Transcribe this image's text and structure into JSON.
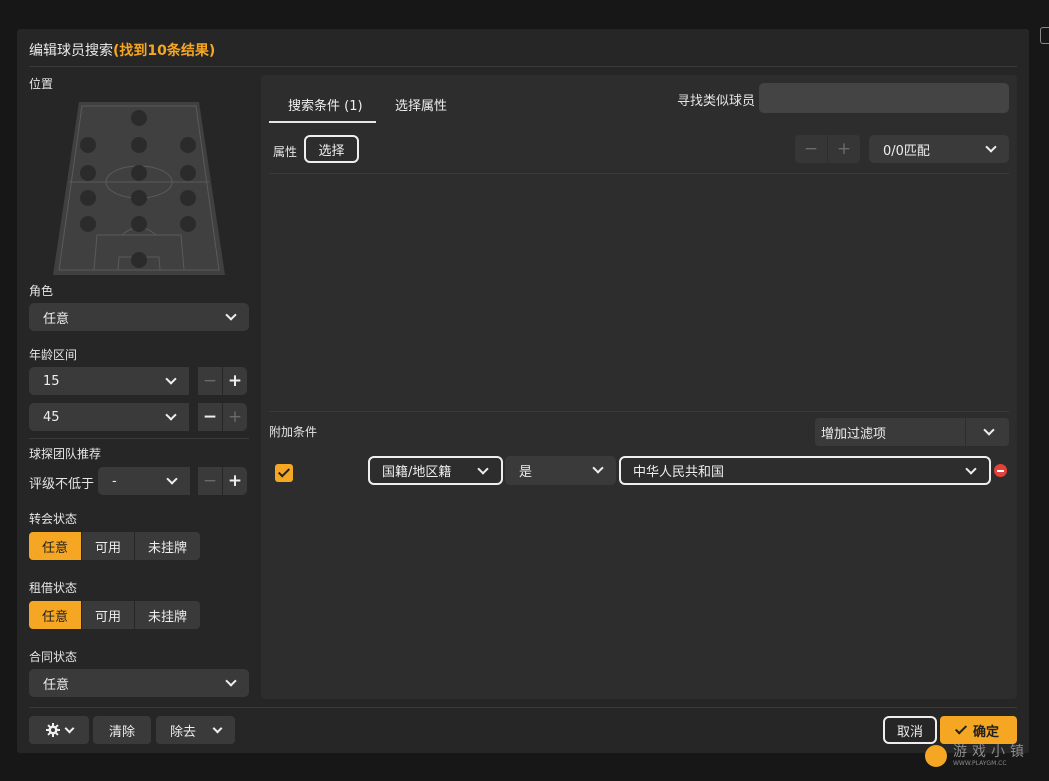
{
  "dialog": {
    "title_prefix": "编辑球员搜索",
    "title_count": "(找到10条结果)"
  },
  "left": {
    "position_label": "位置",
    "role_label": "角色",
    "role_value": "任意",
    "age_label": "年龄区间",
    "age_min": "15",
    "age_max": "45",
    "scout_label": "球探团队推荐",
    "rating_label": "评级不低于",
    "rating_value": "-",
    "transfer_label": "转会状态",
    "transfer_options": [
      "任意",
      "可用",
      "未挂牌"
    ],
    "loan_label": "租借状态",
    "loan_options": [
      "任意",
      "可用",
      "未挂牌"
    ],
    "contract_label": "合同状态",
    "contract_value": "任意"
  },
  "panel": {
    "tab_criteria": "搜索条件 (1)",
    "tab_attributes": "选择属性",
    "similar_label": "寻找类似球员",
    "similar_placeholder": "",
    "attr_label": "属性",
    "select_button": "选择",
    "match_value": "0/0匹配",
    "extra_label": "附加条件",
    "add_filter": "增加过滤项",
    "filter_field": "国籍/地区籍",
    "filter_op": "是",
    "filter_value": "中华人民共和国"
  },
  "footer": {
    "clear": "清除",
    "remove": "除去",
    "cancel": "取消",
    "confirm": "确定"
  },
  "watermark": {
    "text": "游戏小镇",
    "url": "WWW.PLAYGM.CC"
  },
  "colors": {
    "accent": "#f5a623",
    "danger": "#e0433a"
  }
}
